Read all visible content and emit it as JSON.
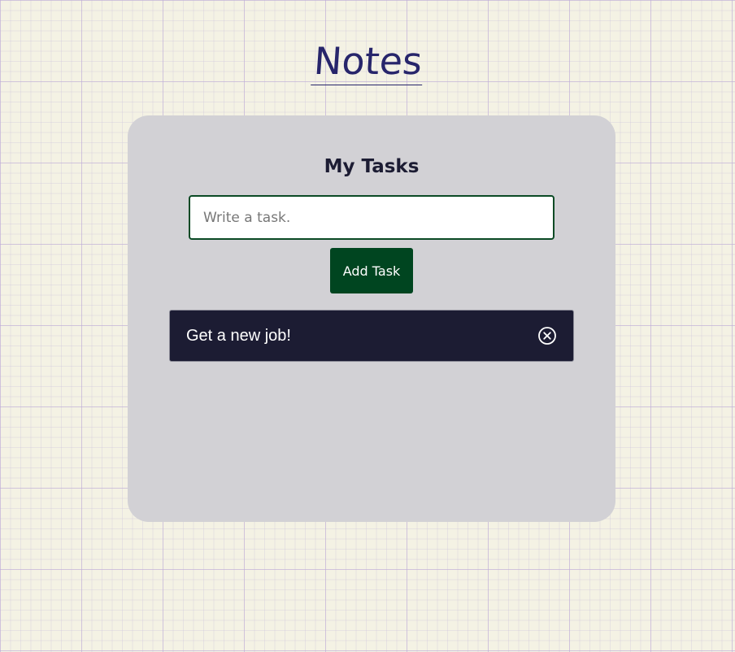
{
  "header": {
    "title": "Notes"
  },
  "card": {
    "title": "My Tasks",
    "input": {
      "placeholder": "Write a task.",
      "value": ""
    },
    "add_button_label": "Add Task"
  },
  "tasks": [
    {
      "text": "Get a new job!",
      "delete_icon": "circle-x-icon"
    }
  ],
  "colors": {
    "background": "#f4f2e4",
    "title": "#27256b",
    "card": "#d2d1d5",
    "button": "#004520",
    "task_item": "#1c1c33"
  }
}
